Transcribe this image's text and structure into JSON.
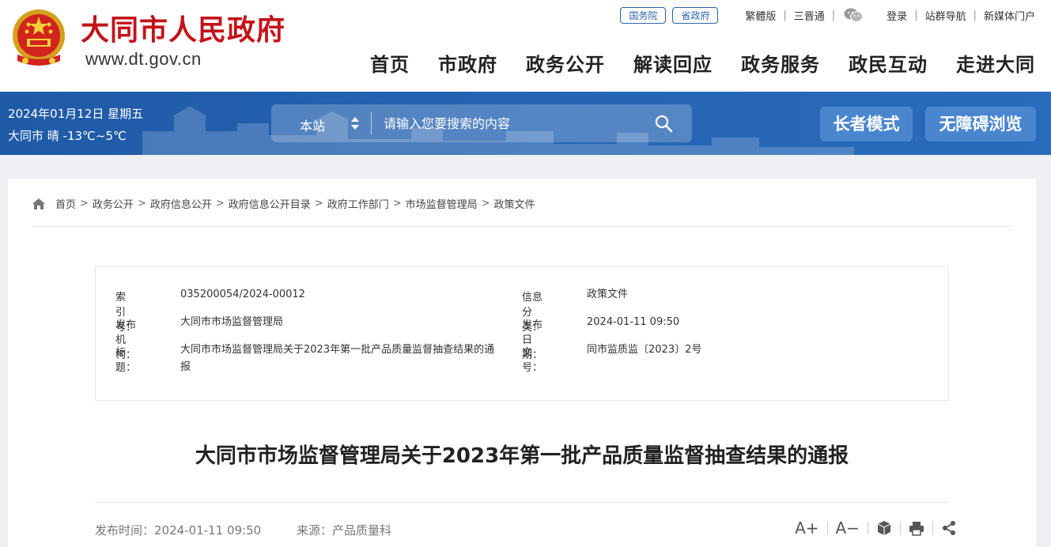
{
  "header": {
    "site_title": "大同市人民政府",
    "site_url": "www.dt.gov.cn",
    "emblem_icon": "national-emblem-icon",
    "topbar": {
      "pills": [
        "国务院",
        "省政府"
      ],
      "links_left": [
        "繁體版",
        "三晋通"
      ],
      "wechat_icon": "wechat-icon",
      "links_right": [
        "登录",
        "站群导航",
        "新媒体门户"
      ]
    },
    "nav": [
      "首页",
      "市政府",
      "政务公开",
      "解读回应",
      "政务服务",
      "政民互动",
      "走进大同"
    ]
  },
  "banner": {
    "date": "2024年01月12日  星期五",
    "weather": "大同市 晴 -13℃~5℃",
    "search": {
      "scope": "本站",
      "placeholder": "请输入您要搜索的内容",
      "icon": "search-icon"
    },
    "elder_mode": "长者模式",
    "accessible": "无障碍浏览"
  },
  "breadcrumb": [
    "首页",
    "政务公开",
    "政府信息公开",
    "政府信息公开目录",
    "政府工作部门",
    "市场监督管理局",
    "政策文件"
  ],
  "info": {
    "index_label": "索 引 号：",
    "index_value": "035200054/2024-00012",
    "category_label": "信息分类：",
    "category_value": "政策文件",
    "publisher_label": "发布机构：",
    "publisher_value": "大同市市场监督管理局",
    "date_label": "发布日期：",
    "date_value": "2024-01-11 09:50",
    "title_label": "标题：",
    "title_value": "大同市市场监督管理局关于2023年第一批产品质量监督抽查结果的通报",
    "docno_label": "文号：",
    "docno_value": "同市监质监〔2023〕2号"
  },
  "article": {
    "title": "大同市市场监督管理局关于2023年第一批产品质量监督抽查结果的通报",
    "publish_time": "发布时间：2024-01-11 09:50",
    "source": "来源：产品质量科",
    "font_increase": "A+",
    "font_decrease": "A−",
    "tool_icons": [
      "cube-icon",
      "print-icon",
      "share-icon"
    ]
  },
  "colors": {
    "brand_red": "#c4121a",
    "banner_blue": "#2462b0",
    "button_blue": "#4a86d0"
  }
}
